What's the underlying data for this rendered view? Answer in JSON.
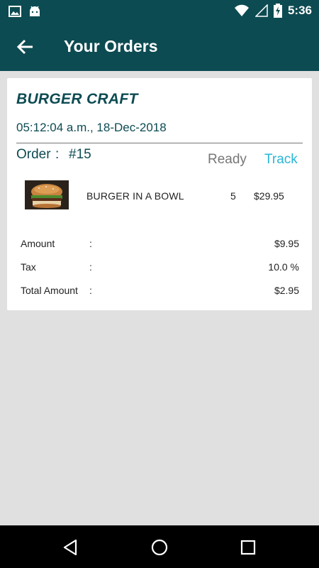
{
  "status_bar": {
    "time": "5:36",
    "icons": [
      "image-icon",
      "android-icon",
      "wifi-icon",
      "signal-icon",
      "battery-charging-icon"
    ]
  },
  "app_bar": {
    "title": "Your Orders",
    "back_icon": "arrow-left-icon"
  },
  "order": {
    "restaurant": "BURGER CRAFT",
    "datetime": "05:12:04 a.m., 18-Dec-2018",
    "order_label": "Order",
    "order_colon": ":",
    "order_number": "#15",
    "status": "Ready",
    "track_label": "Track",
    "items": [
      {
        "name": "BURGER IN A BOWL",
        "quantity": "5",
        "price": "$29.95"
      }
    ],
    "summary": [
      {
        "label": "Amount",
        "colon": ":",
        "value": "$9.95"
      },
      {
        "label": "Tax",
        "colon": ":",
        "value": "10.0 %"
      },
      {
        "label": "Total Amount",
        "colon": ":",
        "value": "$2.95"
      }
    ]
  },
  "colors": {
    "primary": "#0d4b52",
    "accent": "#29b6d8",
    "background": "#e0e0e0"
  },
  "nav_bar": {
    "icons": [
      "back-triangle-icon",
      "home-circle-icon",
      "recents-square-icon"
    ]
  }
}
